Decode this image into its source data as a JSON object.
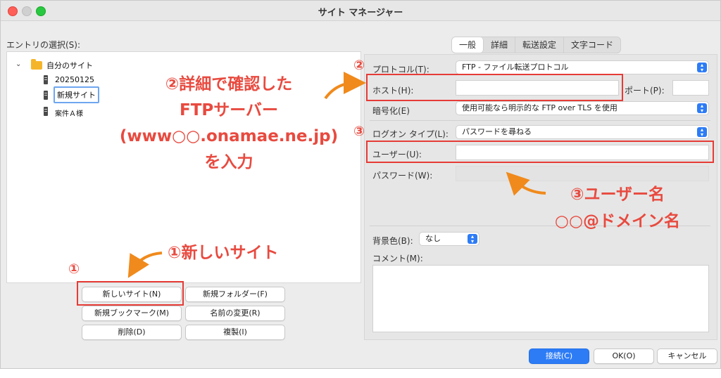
{
  "window": {
    "title": "サイト マネージャー"
  },
  "left": {
    "entry_label": "エントリの選択(S):",
    "tree": {
      "root": "自分のサイト",
      "items": [
        "20250125",
        "新規サイト",
        "案件Ａ様"
      ]
    },
    "buttons": {
      "new_site": "新しいサイト(N)",
      "new_folder": "新規フォルダー(F)",
      "new_bookmark": "新規ブックマーク(M)",
      "rename": "名前の変更(R)",
      "delete": "削除(D)",
      "duplicate": "複製(I)"
    }
  },
  "tabs": [
    "一般",
    "詳細",
    "転送設定",
    "文字コード"
  ],
  "general": {
    "protocol_label": "プロトコル(T):",
    "protocol_value": "FTP - ファイル転送プロトコル",
    "host_label": "ホスト(H):",
    "host_value": "",
    "port_label": "ポート(P):",
    "port_value": "",
    "encryption_label": "暗号化(E)",
    "encryption_value": "使用可能なら明示的な FTP over TLS を使用",
    "logon_label": "ログオン タイプ(L):",
    "logon_value": "パスワードを尋ねる",
    "user_label": "ユーザー(U):",
    "user_value": "",
    "password_label": "パスワード(W):",
    "bgcolor_label": "背景色(B):",
    "bgcolor_value": "なし",
    "comment_label": "コメント(M):",
    "comment_value": ""
  },
  "footer": {
    "connect": "接続(C)",
    "ok": "OK(O)",
    "cancel": "キャンセル"
  },
  "annotations": {
    "n1": "①",
    "n1_text": "①新しいサイト",
    "n2": "②",
    "n2_lines": [
      "②詳細で確認した",
      "FTPサーバー",
      "(www○○.onamae.ne.jp)",
      "を入力"
    ],
    "n3a": "③",
    "n3_lines": [
      "③ユーザー名",
      "○○@ドメイン名"
    ]
  },
  "colors": {
    "annotation": "#e84a3f",
    "highlight_box": "#e63b36",
    "accent": "#2d7cf6"
  }
}
